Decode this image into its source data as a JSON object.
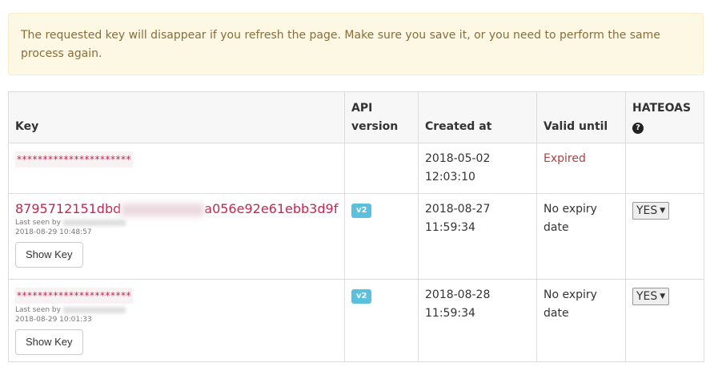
{
  "alert": {
    "text": "The requested key will disappear if you refresh the page. Make sure you save it, or you need to perform the same process again."
  },
  "table": {
    "headers": {
      "key": "Key",
      "api_version": "API version",
      "created_at": "Created at",
      "valid_until": "Valid until",
      "hateoas": "HATEOAS"
    },
    "rows": [
      {
        "key_masked": "**********************",
        "api_version": "",
        "created_date": "2018-05-02",
        "created_time": "12:03:10",
        "valid_until": "Expired"
      },
      {
        "key_start": "8795712151dbd",
        "key_end": "a056e92e61ebb3d9f",
        "last_seen_label": "Last seen by",
        "last_seen_time": "2018-08-29 10:48:57",
        "show_key_label": "Show Key",
        "api_version": "v2",
        "created_date": "2018-08-27",
        "created_time": "11:59:34",
        "valid_until_line1": "No expiry",
        "valid_until_line2": "date",
        "hateoas_value": "YES"
      },
      {
        "key_masked": "**********************",
        "last_seen_label": "Last seen by",
        "last_seen_time": "2018-08-29 10:01:33",
        "show_key_label": "Show Key",
        "api_version": "v2",
        "created_date": "2018-08-28",
        "created_time": "11:59:34",
        "valid_until_line1": "No expiry",
        "valid_until_line2": "date",
        "hateoas_value": "YES"
      }
    ]
  },
  "icons": {
    "help": "question-circle-icon",
    "dropdown": "caret-down-icon"
  },
  "colors": {
    "alert_bg": "#fcf8e3",
    "alert_text": "#8a6d3b",
    "key_text": "#c7254e",
    "badge_bg": "#5bc0de",
    "expired": "#a94442"
  }
}
